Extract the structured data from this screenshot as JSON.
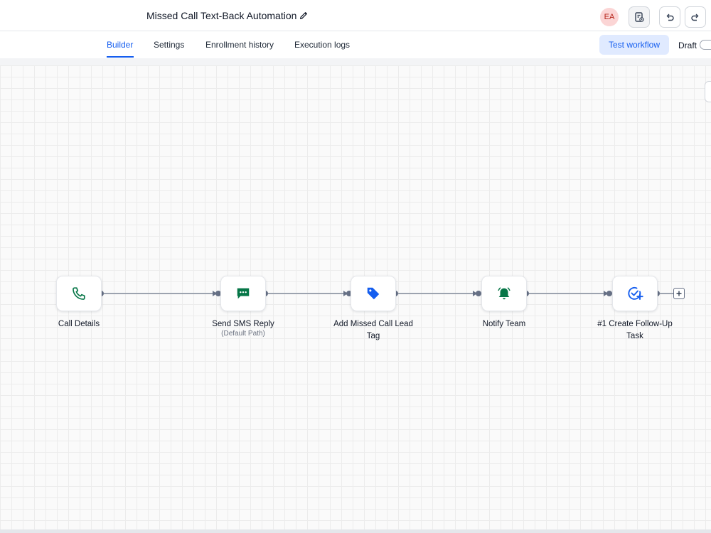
{
  "header": {
    "title": "Missed Call Text-Back Automation",
    "avatar_initials": "EA",
    "icons": [
      "edit-icon",
      "notes-icon",
      "undo-icon",
      "redo-icon"
    ]
  },
  "tabs": [
    {
      "label": "Builder",
      "active": true
    },
    {
      "label": "Settings",
      "active": false
    },
    {
      "label": "Enrollment history",
      "active": false
    },
    {
      "label": "Execution logs",
      "active": false
    }
  ],
  "actions": {
    "test_label": "Test workflow",
    "draft_label": "Draft"
  },
  "nodes": [
    {
      "label": "Call Details",
      "sub": "",
      "icon": "phone-icon",
      "color": "#067647"
    },
    {
      "label": "Send SMS Reply",
      "sub": "(Default Path)",
      "icon": "sms-icon",
      "color": "#067647"
    },
    {
      "label": "Add Missed Call Lead Tag",
      "sub": "",
      "icon": "tag-icon",
      "color": "#155eef"
    },
    {
      "label": "Notify Team",
      "sub": "",
      "icon": "bell-icon",
      "color": "#067647"
    },
    {
      "label": "#1 Create Follow-Up Task",
      "sub": "",
      "icon": "task-icon",
      "color": "#155eef"
    }
  ],
  "colors": {
    "accent": "#155eef",
    "green": "#067647",
    "connector": "#667085"
  }
}
